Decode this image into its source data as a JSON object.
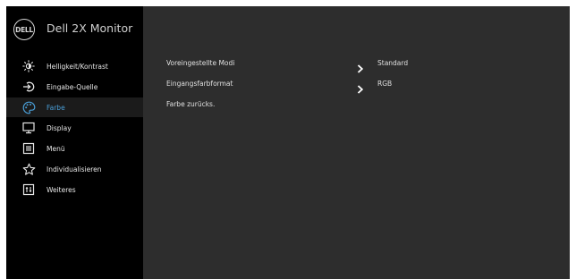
{
  "header": {
    "logo_text": "DELL",
    "title": "Dell 2X Monitor"
  },
  "sidebar": {
    "items": [
      {
        "label": "Helligkeit/Kontrast",
        "icon": "brightness-icon",
        "active": false
      },
      {
        "label": "Eingabe-Quelle",
        "icon": "input-source-icon",
        "active": false
      },
      {
        "label": "Farbe",
        "icon": "color-palette-icon",
        "active": true
      },
      {
        "label": "Display",
        "icon": "display-icon",
        "active": false
      },
      {
        "label": "Menü",
        "icon": "menu-icon",
        "active": false
      },
      {
        "label": "Individualisieren",
        "icon": "star-icon",
        "active": false
      },
      {
        "label": "Weiteres",
        "icon": "others-icon",
        "active": false
      }
    ]
  },
  "main": {
    "rows": [
      {
        "label": "Voreingestellte Modi",
        "value": "Standard"
      },
      {
        "label": "Eingangsfarbformat",
        "value": "RGB"
      },
      {
        "label": "Farbe zurücks.",
        "value": ""
      }
    ]
  },
  "colors": {
    "accent": "#4a9fd8",
    "sidebar_bg": "#000000",
    "content_bg": "#2d2d2d"
  }
}
